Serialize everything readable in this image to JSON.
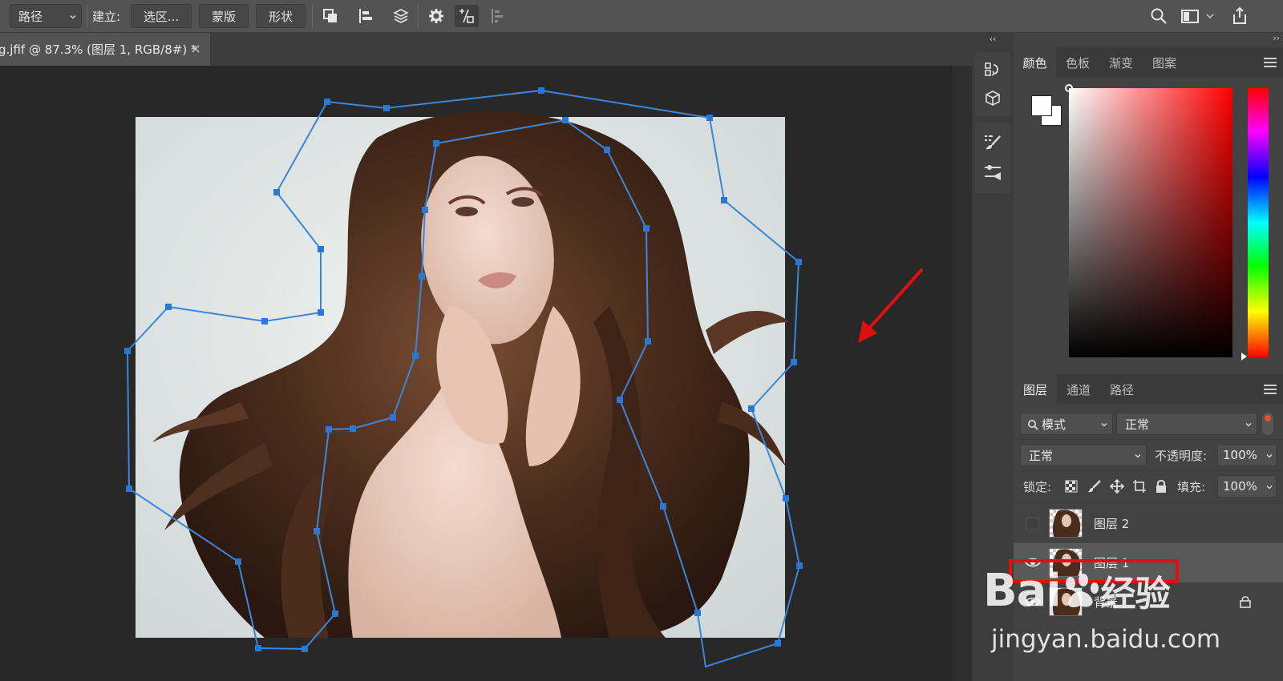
{
  "options_bar": {
    "mode_select": "路径",
    "make_label": "建立:",
    "selection_button": "选区...",
    "mask_button": "蒙版",
    "shape_button": "形状"
  },
  "document": {
    "tab_title": "g.jfif @ 87.3% (图层 1, RGB/8#) *",
    "close_glyph": "×"
  },
  "color_panel": {
    "tabs": [
      "颜色",
      "色板",
      "渐变",
      "图案"
    ],
    "active_tab": "颜色"
  },
  "layers_panel": {
    "tabs": [
      "图层",
      "通道",
      "路径"
    ],
    "active_tab": "图层",
    "filter_kind": "模式",
    "filter_mode": "正常",
    "blend_mode": "正常",
    "opacity_label": "不透明度:",
    "opacity_value": "100%",
    "lock_label": "锁定:",
    "fill_label": "填充:",
    "fill_value": "100%",
    "layers": [
      {
        "name": "图层 2",
        "visible": false
      },
      {
        "name": "图层 1",
        "visible": true,
        "selected": true
      },
      {
        "name": "背景",
        "visible": true,
        "locked": true
      }
    ]
  },
  "annotations": {
    "arrow_color": "#e01010",
    "highlight_color": "#e01010"
  },
  "watermark": {
    "brand": "Bai",
    "brand_suffix": "经验",
    "url": "jingyan.baidu.com"
  },
  "colors": {
    "path_stroke": "#3b86d8",
    "path_anchor": "#2a78d6",
    "app_bg": "#282828",
    "panel_bg": "#424242"
  }
}
